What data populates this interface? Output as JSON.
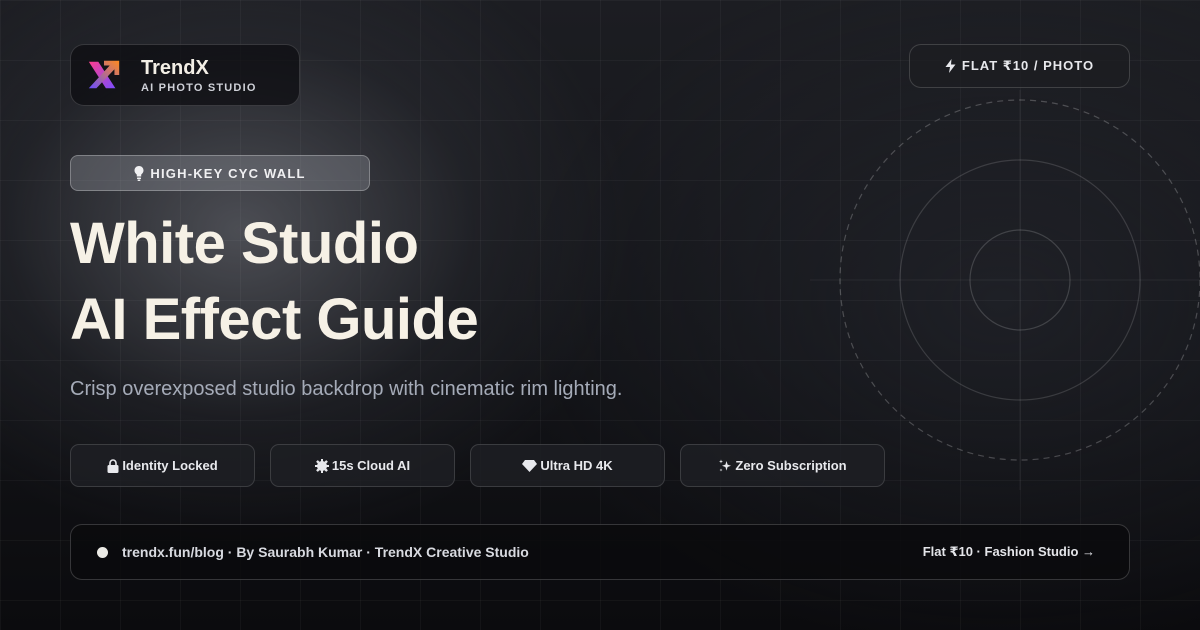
{
  "brand": {
    "name": "TrendX",
    "subtitle": "AI PHOTO STUDIO",
    "logo_icon": "x-arrow-logo-icon",
    "logo_colors": [
      "#ff3d8f",
      "#7b4dff",
      "#ff8a1f"
    ]
  },
  "price_pill": {
    "icon": "lightning-icon",
    "label": "FLAT ₹10 / PHOTO"
  },
  "tag": {
    "icon": "light-bulb-icon",
    "label": "HIGH-KEY CYC WALL"
  },
  "headline": {
    "line1": "White Studio",
    "line2": "AI Effect Guide"
  },
  "subtitle": "Crisp overexposed studio backdrop with cinematic rim lighting.",
  "features": [
    {
      "icon": "lock-icon",
      "label": "Identity Locked"
    },
    {
      "icon": "gear-icon",
      "label": "15s Cloud AI"
    },
    {
      "icon": "diamond-icon",
      "label": "Ultra HD 4K"
    },
    {
      "icon": "sparkles-icon",
      "label": "Zero Subscription"
    }
  ],
  "footer": {
    "left": "trendx.fun/blog · By Saurabh Kumar · TrendX Creative Studio",
    "right": "Flat ₹10 · Fashion Studio →"
  },
  "colors": {
    "headline": "#f6f1e6",
    "subtitle": "#a5abb8",
    "background": "#131418"
  }
}
